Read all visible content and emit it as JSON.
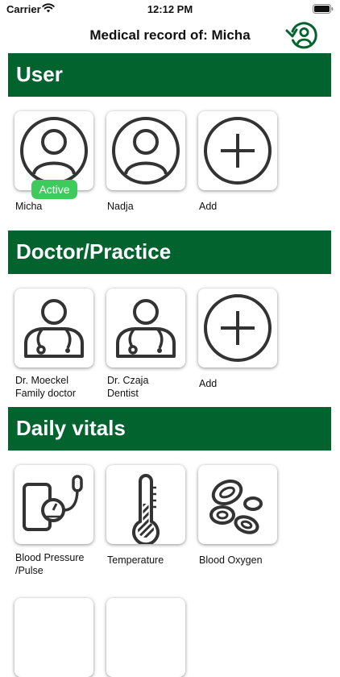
{
  "status_bar": {
    "carrier": "Carrier",
    "time": "12:12 PM",
    "wifi_icon": "wifi-icon",
    "battery_icon": "battery-icon"
  },
  "nav": {
    "title": "Medical record of: Micha",
    "switch_user_icon": "switch-user-icon"
  },
  "theme": {
    "section_header_color": "#03632f",
    "active_badge_color": "#3ecb5c",
    "icon_color": "#333333"
  },
  "sections": {
    "user": {
      "title": "User",
      "items": [
        {
          "label": "Micha",
          "icon": "user-avatar-icon",
          "badge": "Active"
        },
        {
          "label": "Nadja",
          "icon": "user-avatar-icon"
        },
        {
          "label": "Add",
          "icon": "add-circle-icon"
        }
      ]
    },
    "doctor": {
      "title": "Doctor/Practice",
      "items": [
        {
          "label_line1": "Dr. Moeckel",
          "label_line2": "Family doctor",
          "icon": "doctor-icon"
        },
        {
          "label_line1": "Dr. Czaja",
          "label_line2": "Dentist",
          "icon": "doctor-icon"
        },
        {
          "label_line1": "Add",
          "icon": "add-circle-icon"
        }
      ]
    },
    "vitals": {
      "title": "Daily vitals",
      "items": [
        {
          "label_line1": "Blood Pressure",
          "label_line2": "/Pulse",
          "icon": "blood-pressure-icon"
        },
        {
          "label_line1": "Temperature",
          "icon": "thermometer-icon"
        },
        {
          "label_line1": "Blood Oxygen",
          "icon": "blood-cells-icon"
        }
      ]
    }
  }
}
